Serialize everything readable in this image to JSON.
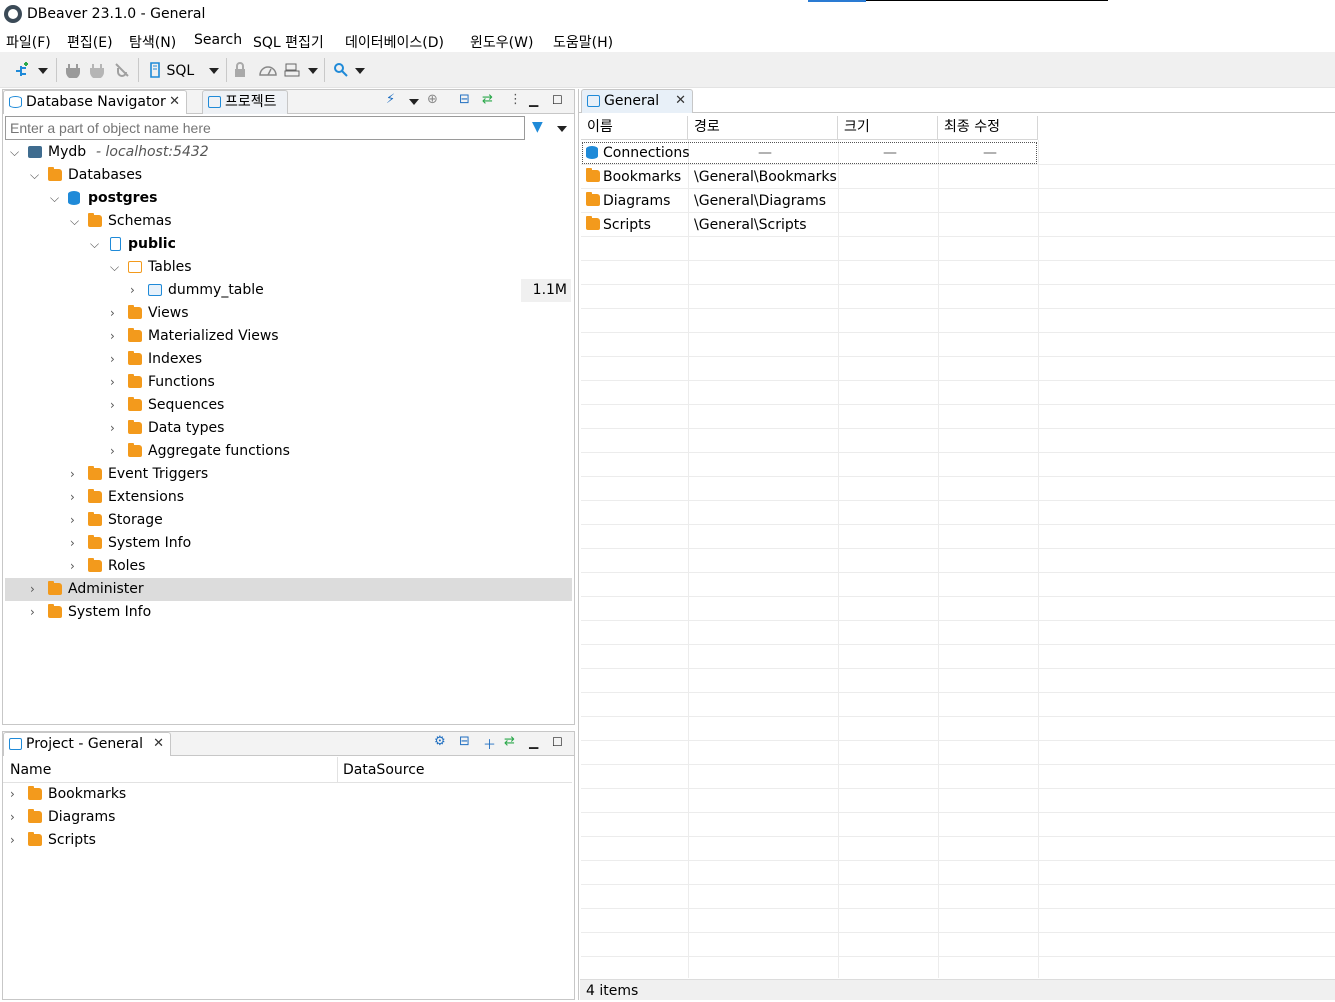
{
  "window": {
    "title": "DBeaver 23.1.0 - General"
  },
  "menu": [
    "파일(F)",
    "편집(E)",
    "탐색(N)",
    "Search",
    "SQL 편집기",
    "데이터베이스(D)",
    "윈도우(W)",
    "도움말(H)"
  ],
  "toolbar": {
    "sql_label": "SQL"
  },
  "navigator": {
    "tab_label": "Database Navigator",
    "tab2_label": "프로젝트",
    "filter_placeholder": "Enter a part of object name here",
    "connection": {
      "name": "Mydb",
      "host": "- localhost:5432"
    },
    "items": {
      "databases": "Databases",
      "postgres": "postgres",
      "schemas": "Schemas",
      "public": "public",
      "tables": "Tables",
      "dummy_table": "dummy_table",
      "dummy_size": "1.1M",
      "views": "Views",
      "mat_views": "Materialized Views",
      "indexes": "Indexes",
      "functions": "Functions",
      "sequences": "Sequences",
      "data_types": "Data types",
      "aggregate": "Aggregate functions",
      "event_triggers": "Event Triggers",
      "extensions": "Extensions",
      "storage": "Storage",
      "system_info": "System Info",
      "roles": "Roles",
      "administer": "Administer",
      "system_info2": "System Info"
    }
  },
  "project_panel": {
    "tab_label": "Project - General",
    "col_name": "Name",
    "col_datasource": "DataSource",
    "rows": [
      "Bookmarks",
      "Diagrams",
      "Scripts"
    ]
  },
  "editor": {
    "tab_label": "General",
    "columns": [
      "이름",
      "경로",
      "크기",
      "최종 수정"
    ],
    "rows": [
      {
        "name": "Connections",
        "path": "—",
        "size": "—",
        "modified": "—"
      },
      {
        "name": "Bookmarks",
        "path": "\\General\\Bookmarks",
        "size": "",
        "modified": ""
      },
      {
        "name": "Diagrams",
        "path": "\\General\\Diagrams",
        "size": "",
        "modified": ""
      },
      {
        "name": "Scripts",
        "path": "\\General\\Scripts",
        "size": "",
        "modified": ""
      }
    ],
    "status": "4 items"
  }
}
